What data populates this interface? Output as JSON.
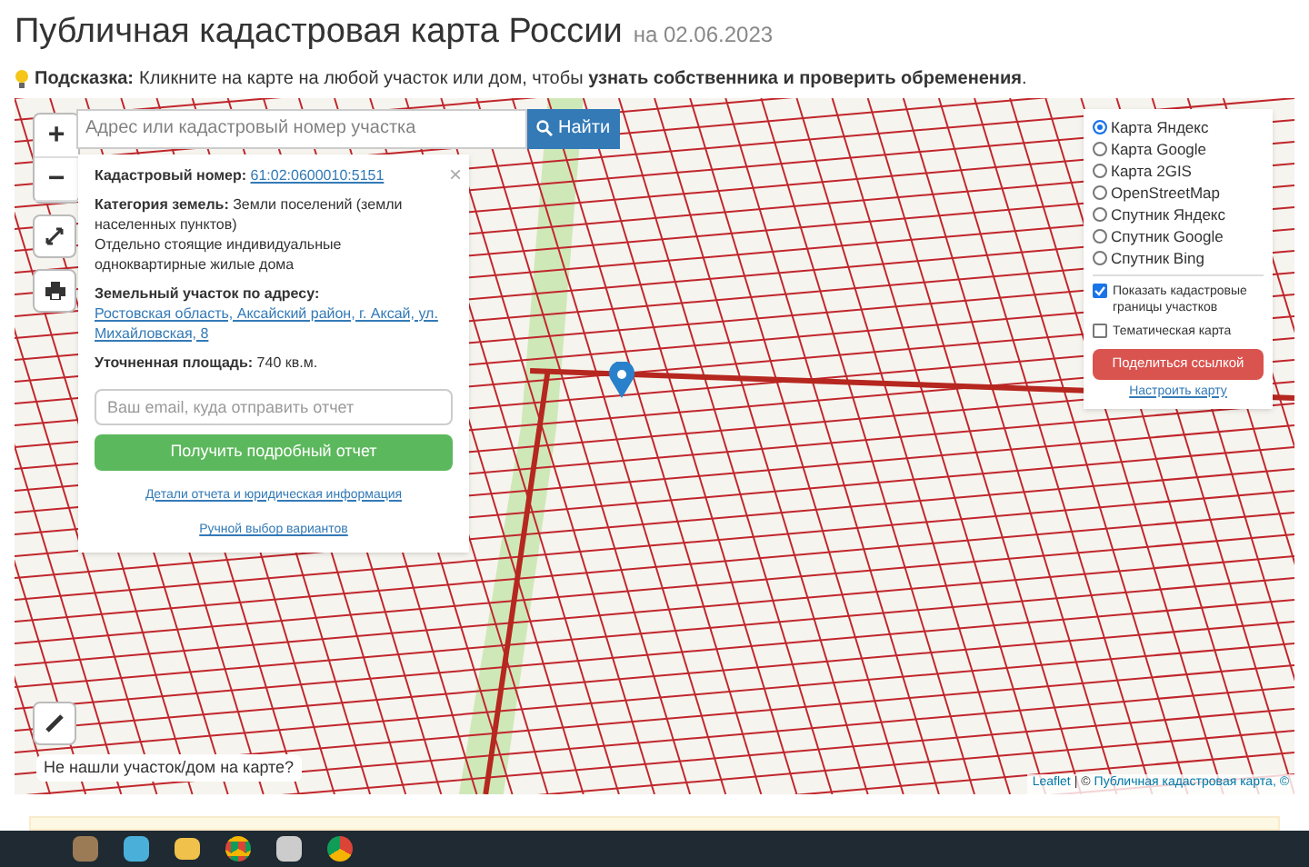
{
  "header": {
    "title": "Публичная кадастровая карта России",
    "date": "на 02.06.2023"
  },
  "hint": {
    "label": "Подсказка:",
    "text": "Кликните на карте на любой участок или дом, чтобы **узнать собственника и проверить обременения**."
  },
  "search": {
    "placeholder": "Адрес или кадастровый номер участка",
    "button": "Найти"
  },
  "zoom_controls": [
    "+",
    "−"
  ],
  "popup": {
    "close": "×",
    "fields": [
      {
        "kind": "link",
        "label": "Кадастровый номер:",
        "value": "61:02:0600010:5151"
      },
      {
        "kind": "text",
        "label": "Категория земель:",
        "value": "Земли поселений (земли населенных пунктов)",
        "extra": "Отдельно стоящие индивидуальные одноквартирные жилые дома"
      },
      {
        "kind": "link",
        "label": "Земельный участок по адресу:",
        "value": "Ростовская область, Аксайский район, г. Аксай, ул. Михайловская, 8"
      },
      {
        "kind": "text",
        "label": "Уточненная площадь:",
        "value": "740 кв.м."
      }
    ],
    "email_placeholder": "Ваш email, куда отправить отчет",
    "report_button": "Получить подробный отчет",
    "links": [
      "Детали отчета и юридическая информация",
      "Ручной выбор вариантов"
    ]
  },
  "layers": {
    "options": [
      {
        "label": "Карта Яндекс",
        "selected": true
      },
      {
        "label": "Карта Google",
        "selected": false
      },
      {
        "label": "Карта 2GIS",
        "selected": false
      },
      {
        "label": "OpenStreetMap",
        "selected": false
      },
      {
        "label": "Спутник Яндекс",
        "selected": false
      },
      {
        "label": "Спутник Google",
        "selected": false
      },
      {
        "label": "Спутник Bing",
        "selected": false
      }
    ],
    "checks": [
      {
        "label": "Показать кадастровые границы участков",
        "checked": true
      },
      {
        "label": "Тематическая карта",
        "checked": false
      }
    ],
    "share_button": "Поделиться ссылкой",
    "settings_link": "Настроить карту"
  },
  "not_found": "Не нашли участок/дом на карте?",
  "attribution": {
    "leaflet": "Leaflet",
    "separator": "| ©",
    "source": "Публичная кадастровая карта, ©"
  }
}
